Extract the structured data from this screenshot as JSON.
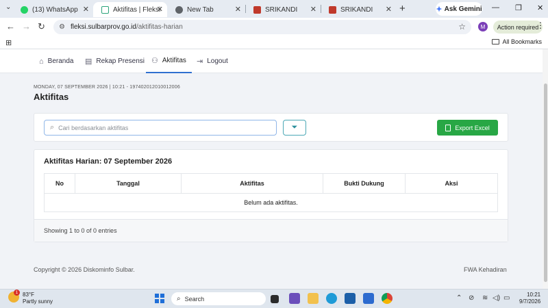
{
  "browser": {
    "tabs": [
      {
        "title": "(13) WhatsApp",
        "favicon": "whatsapp-icon",
        "active": false
      },
      {
        "title": "Aktifitas | Fleksi",
        "favicon": "fleksi-icon",
        "active": true
      },
      {
        "title": "New Tab",
        "favicon": "chrome-icon",
        "active": false
      },
      {
        "title": "SRIKANDI",
        "favicon": "srikandi-icon",
        "active": false
      },
      {
        "title": "SRIKANDI",
        "favicon": "srikandi-icon",
        "active": false
      }
    ],
    "gemini_label": "Ask Gemini",
    "url_domain": "fleksi.sulbarprov.go.id",
    "url_path": "/aktifitas-harian",
    "profile_initial": "M",
    "action_required": "Action required",
    "all_bookmarks": "All Bookmarks"
  },
  "nav": {
    "items": [
      {
        "label": "Beranda",
        "icon": "home-icon",
        "active": false
      },
      {
        "label": "Rekap Presensi",
        "icon": "clipboard-icon",
        "active": false
      },
      {
        "label": "Aktifitas",
        "icon": "user-icon",
        "active": true
      },
      {
        "label": "Logout",
        "icon": "logout-icon",
        "active": false
      }
    ]
  },
  "header": {
    "crumb": "MONDAY, 07 SEPTEMBER 2026 | 10:21 - 197402012010012006",
    "title": "Aktifitas"
  },
  "toolbar": {
    "search_placeholder": "Cari berdasarkan aktifitas",
    "search_value": "",
    "export_label": "Export Excel"
  },
  "table": {
    "title": "Aktifitas Harian: 07 September 2026",
    "columns": [
      "No",
      "Tanggal",
      "Aktifitas",
      "Bukti Dukung",
      "Aksi"
    ],
    "empty_message": "Belum ada aktifitas.",
    "showing": "Showing 1 to 0 of 0 entries"
  },
  "footer": {
    "copyright": "Copyright © 2026 Diskominfo Sulbar.",
    "brand": "FWA Kehadiran"
  },
  "taskbar": {
    "weather_temp": "83°F",
    "weather_desc": "Partly sunny",
    "weather_badge": "1",
    "search_label": "Search",
    "time": "10:21",
    "date": "9/7/2026"
  }
}
